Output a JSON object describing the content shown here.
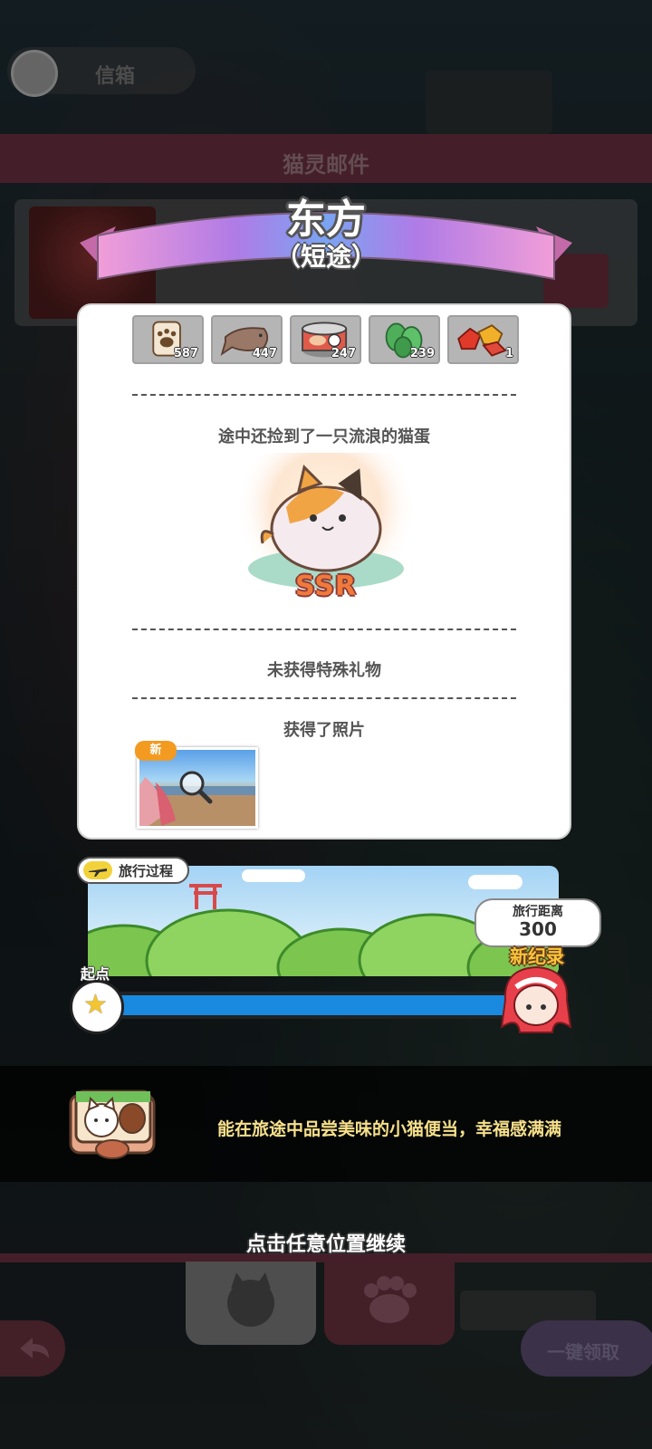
{
  "background": {
    "header_pill_text": "信箱",
    "mail_bar_title": "猫灵邮件",
    "purple_button_label": "一键领取"
  },
  "dialog": {
    "title": "东方",
    "subtitle": "（短途）",
    "items": [
      {
        "icon": "paw-can-icon",
        "count": "587"
      },
      {
        "icon": "dried-fish-icon",
        "count": "447"
      },
      {
        "icon": "cat-food-can-icon",
        "count": "247"
      },
      {
        "icon": "catnip-leaves-icon",
        "count": "239"
      },
      {
        "icon": "red-gems-icon",
        "count": "1"
      }
    ],
    "stray_egg_text": "途中还捡到了一只流浪的猫蛋",
    "egg_rarity": "SSR",
    "special_gift_text": "未获得特殊礼物",
    "photo_section_title": "获得了照片",
    "photo_new_tag": "新"
  },
  "travel": {
    "tag_label": "旅行过程",
    "start_label": "起点",
    "distance_label": "旅行距离",
    "distance_value": "300",
    "record_label": "新纪录",
    "progress": 1.0
  },
  "message": {
    "text": "能在旅途中品尝美味的小猫便当，幸福感满满"
  },
  "continue_text": "点击任意位置继续",
  "colors": {
    "accent_pink": "#7d3a4c",
    "progress_blue": "#1a8ae0",
    "record_yellow": "#f7c63a",
    "message_yellow": "#f6e08a"
  }
}
